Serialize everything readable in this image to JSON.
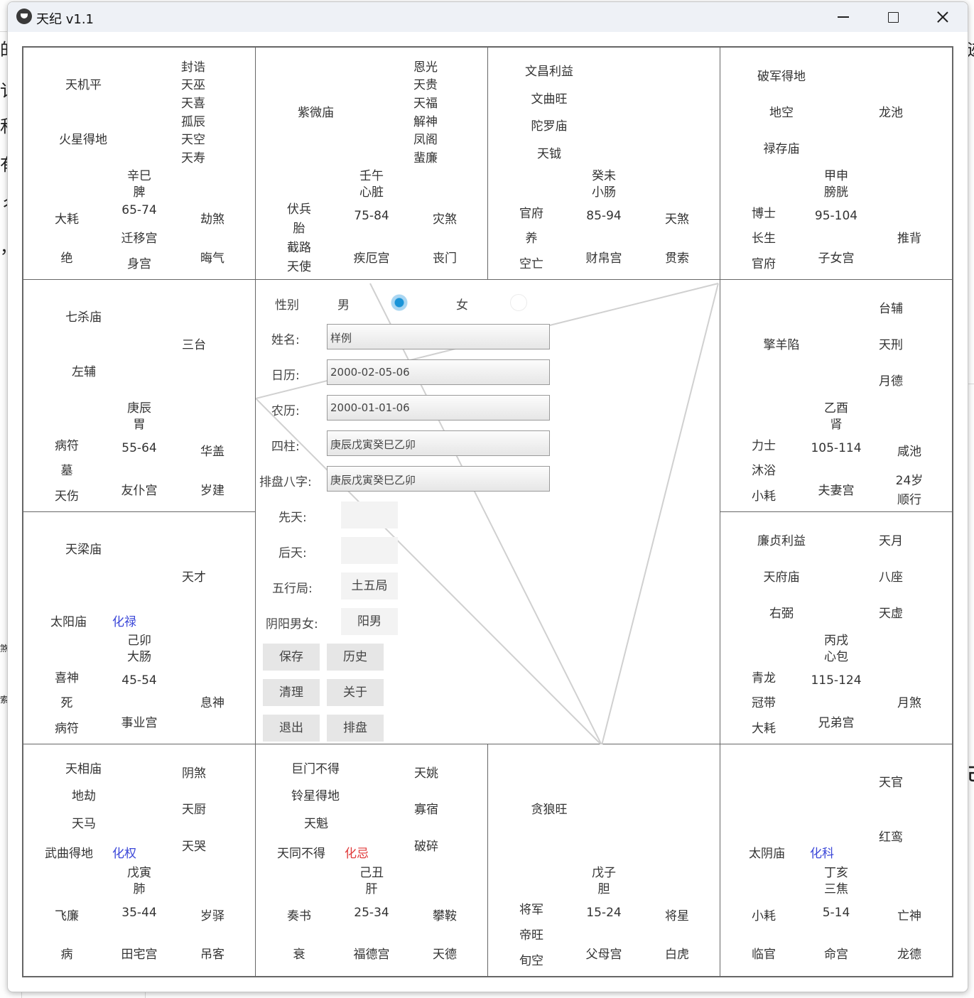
{
  "window": {
    "title": "天纪 v1.1"
  },
  "background": {
    "left_chars": [
      "的",
      "讠",
      "和",
      "有",
      "彳",
      "，",
      "煞",
      "索"
    ],
    "right_chars": [
      "迹",
      "己"
    ]
  },
  "palaces": {
    "si": {
      "main": [
        "天机平",
        "火星得地"
      ],
      "minor": [
        "封诰",
        "天巫",
        "天喜",
        "孤辰",
        "天空",
        "天寿"
      ],
      "stem": "辛巳",
      "organ": "脾",
      "age": "65-74",
      "name": "迁移宫",
      "body": "身宫",
      "left": [
        "大耗",
        "绝"
      ],
      "right": [
        "劫煞",
        "晦气"
      ]
    },
    "wu": {
      "main": [
        "紫微庙"
      ],
      "minor": [
        "恩光",
        "天贵",
        "天福",
        "解神",
        "凤阁",
        "蜚廉"
      ],
      "stem": "壬午",
      "organ": "心脏",
      "age": "75-84",
      "name": "疾厄宫",
      "left": [
        "伏兵",
        "胎",
        "截路",
        "天使"
      ],
      "right": [
        "灾煞",
        "丧门"
      ]
    },
    "wei": {
      "main": [
        "文昌利益",
        "文曲旺",
        "陀罗庙",
        "天钺"
      ],
      "stem": "癸未",
      "organ": "小肠",
      "age": "85-94",
      "name": "财帛宫",
      "left": [
        "官府",
        "养",
        "空亡"
      ],
      "right": [
        "天煞",
        "贯索"
      ]
    },
    "shen": {
      "main": [
        "破军得地",
        "地空",
        "禄存庙"
      ],
      "minor": [
        "龙池"
      ],
      "stem": "甲申",
      "organ": "膀胱",
      "age": "95-104",
      "name": "子女宫",
      "left": [
        "博士",
        "长生",
        "官府"
      ],
      "right": [
        "推背"
      ]
    },
    "chen": {
      "main": [
        "七杀庙",
        "左辅"
      ],
      "minor": [
        "三台"
      ],
      "stem": "庚辰",
      "organ": "胃",
      "age": "55-64",
      "name": "友仆宫",
      "left": [
        "病符",
        "墓",
        "天伤"
      ],
      "right": [
        "华盖",
        "岁建"
      ]
    },
    "you": {
      "main": [
        "擎羊陷"
      ],
      "minor": [
        "台辅",
        "天刑",
        "月德"
      ],
      "stem": "乙酉",
      "organ": "肾",
      "age": "105-114",
      "name": "夫妻宫",
      "left": [
        "力士",
        "沐浴",
        "小耗"
      ],
      "right": [
        "咸池",
        "24岁",
        "顺行"
      ]
    },
    "mao": {
      "main": [
        "天梁庙",
        "太阳庙"
      ],
      "hua": "化禄",
      "minor": [
        "天才"
      ],
      "stem": "己卯",
      "organ": "大肠",
      "age": "45-54",
      "name": "事业宫",
      "left": [
        "喜神",
        "死",
        "病符"
      ],
      "right": [
        "息神"
      ]
    },
    "xu": {
      "main": [
        "廉贞利益",
        "天府庙",
        "右弼"
      ],
      "minor": [
        "天月",
        "八座",
        "天虚"
      ],
      "stem": "丙戌",
      "organ": "心包",
      "age": "115-124",
      "name": "兄弟宫",
      "left": [
        "青龙",
        "冠带",
        "大耗"
      ],
      "right": [
        "月煞"
      ]
    },
    "yin": {
      "main": [
        "天相庙",
        "地劫",
        "天马",
        "武曲得地"
      ],
      "hua": "化权",
      "minor": [
        "阴煞",
        "天厨",
        "天哭"
      ],
      "stem": "戊寅",
      "organ": "肺",
      "age": "35-44",
      "name": "田宅宫",
      "left": [
        "飞廉",
        "病"
      ],
      "right": [
        "岁驿",
        "吊客"
      ]
    },
    "chou": {
      "main": [
        "巨门不得",
        "铃星得地",
        "天魁",
        "天同不得"
      ],
      "hua": "化忌",
      "minor": [
        "天姚",
        "寡宿",
        "破碎"
      ],
      "stem": "己丑",
      "organ": "肝",
      "age": "25-34",
      "name": "福德宫",
      "left": [
        "奏书",
        "衰"
      ],
      "right": [
        "攀鞍",
        "天德"
      ]
    },
    "zi": {
      "main": [
        "贪狼旺"
      ],
      "stem": "戊子",
      "organ": "胆",
      "age": "15-24",
      "name": "父母宫",
      "left": [
        "将军",
        "帝旺",
        "旬空"
      ],
      "right": [
        "将星",
        "白虎"
      ]
    },
    "hai": {
      "main": [
        "太阴庙"
      ],
      "hua": "化科",
      "minor": [
        "天官",
        "红鸾"
      ],
      "stem": "丁亥",
      "organ": "三焦",
      "age": "5-14",
      "name": "命宫",
      "left": [
        "小耗",
        "临官"
      ],
      "right": [
        "亡神",
        "龙德"
      ]
    }
  },
  "form": {
    "gender_label": "性别",
    "male": "男",
    "female": "女",
    "gender_selected": "男",
    "name_label": "姓名:",
    "name_value": "样例",
    "solar_label": "日历:",
    "solar_value": "2000-02-05-06",
    "lunar_label": "农历:",
    "lunar_value": "2000-01-01-06",
    "pillars_label": "四柱:",
    "pillars_value": "庚辰戊寅癸巳乙卯",
    "bazi_label": "排盘八字:",
    "bazi_value": "庚辰戊寅癸巳乙卯",
    "xiantian_label": "先天:",
    "xiantian_value": "",
    "houtian_label": "后天:",
    "houtian_value": "",
    "wuxing_label": "五行局:",
    "wuxing_value": "土五局",
    "yinyang_label": "阴阳男女:",
    "yinyang_value": "阳男"
  },
  "buttons": {
    "save": "保存",
    "history": "历史",
    "clear": "清理",
    "about": "关于",
    "exit": "退出",
    "chart": "排盘"
  }
}
